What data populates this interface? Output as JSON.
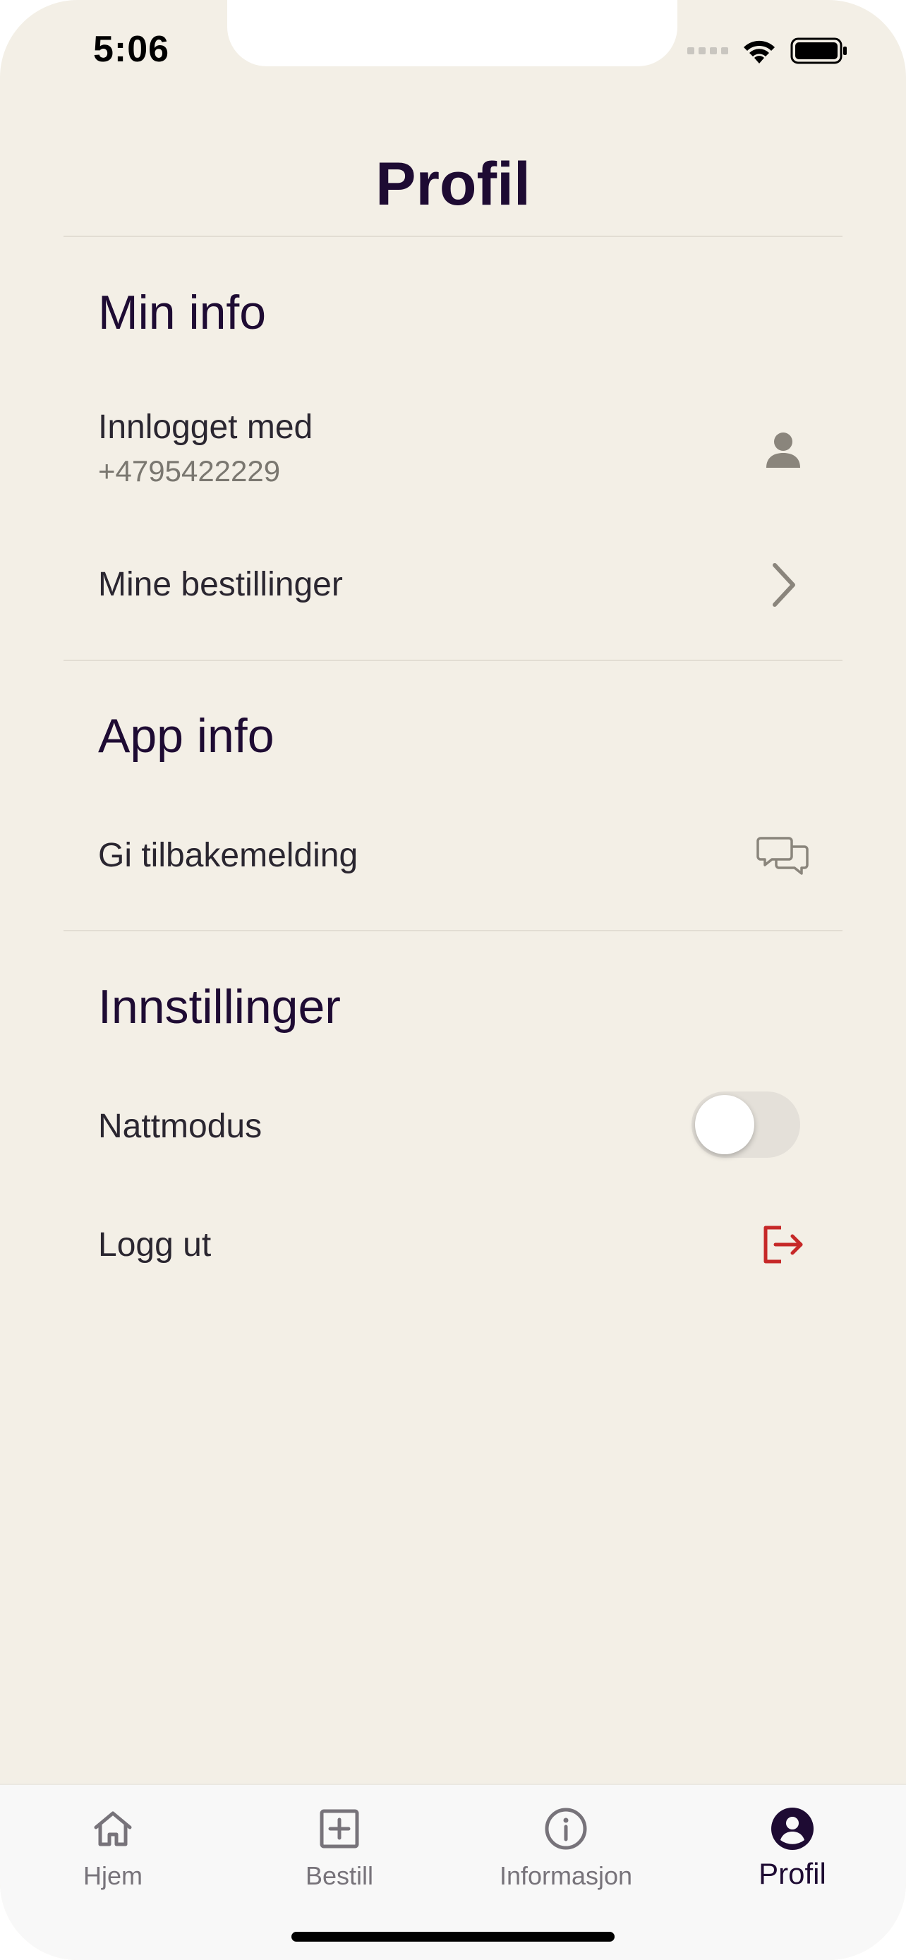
{
  "status_bar": {
    "time": "5:06"
  },
  "header": {
    "title": "Profil"
  },
  "sections": {
    "min_info": {
      "title": "Min info",
      "logged_in_label": "Innlogget med",
      "logged_in_value": "+4795422229",
      "orders_label": "Mine bestillinger"
    },
    "app_info": {
      "title": "App info",
      "feedback_label": "Gi tilbakemelding"
    },
    "settings": {
      "title": "Innstillinger",
      "night_mode_label": "Nattmodus",
      "night_mode_on": false,
      "logout_label": "Logg ut"
    }
  },
  "bottom_nav": {
    "items": [
      {
        "label": "Hjem",
        "icon": "home-icon"
      },
      {
        "label": "Bestill",
        "icon": "plus-square-icon"
      },
      {
        "label": "Informasjon",
        "icon": "info-icon"
      },
      {
        "label": "Profil",
        "icon": "profile-icon",
        "active": true
      }
    ]
  },
  "colors": {
    "background": "#f3efe6",
    "heading": "#1e0b33",
    "logout_accent": "#c62828",
    "nav_inactive": "#77737a"
  }
}
